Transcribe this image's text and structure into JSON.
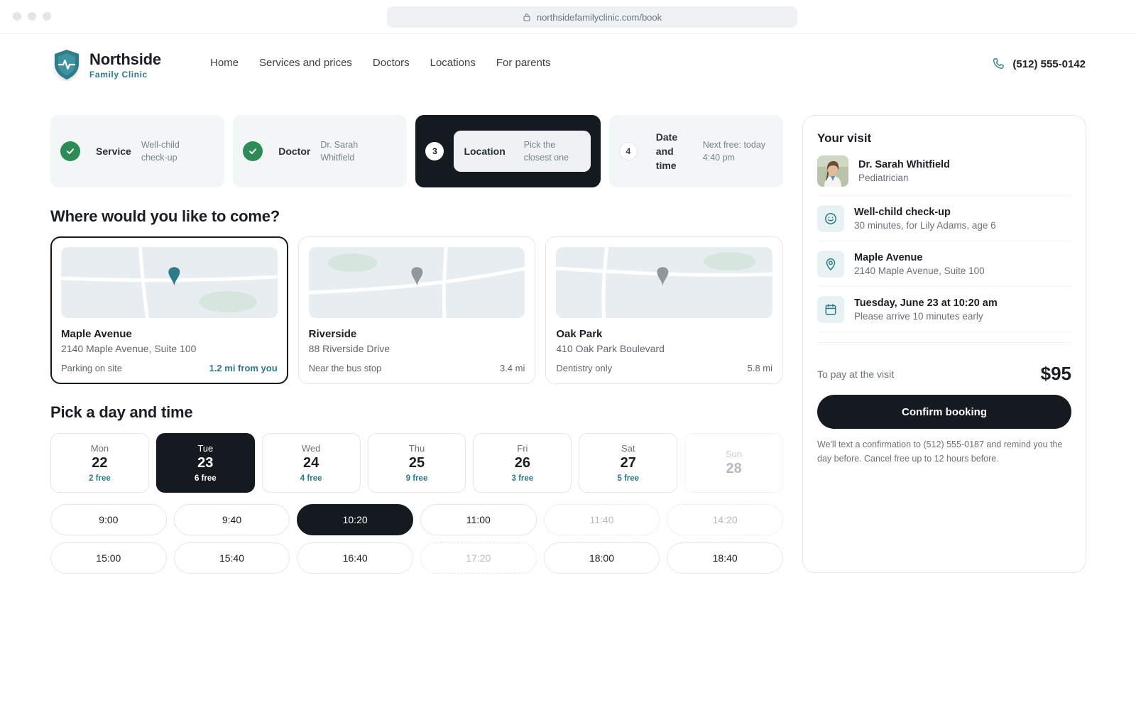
{
  "browser": {
    "url": "northsidefamilyclinic.com/book"
  },
  "brand": {
    "name": "Northside",
    "tagline": "Family Clinic",
    "color": "#2d7b87"
  },
  "nav": [
    "Home",
    "Services and prices",
    "Doctors",
    "Locations",
    "For parents"
  ],
  "phone": "(512) 555-0142",
  "steps": [
    {
      "label": "Service",
      "sub": "Well-child check-up",
      "status": "done"
    },
    {
      "label": "Doctor",
      "sub": "Dr. Sarah Whitfield",
      "status": "done"
    },
    {
      "number": "3",
      "label": "Location",
      "sub": "Pick the closest one",
      "status": "active"
    },
    {
      "number": "4",
      "label": "Date and time",
      "sub": "Next free: today 4:40 pm",
      "status": "pending"
    }
  ],
  "location_heading": "Where would you like to come?",
  "locations": [
    {
      "name": "Maple Avenue",
      "address": "2140 Maple Avenue, Suite 100",
      "note": "Parking on site",
      "distance": "1.2 mi from you",
      "selected": true
    },
    {
      "name": "Riverside",
      "address": "88 Riverside Drive",
      "note": "Near the bus stop",
      "distance": "3.4 mi",
      "selected": false
    },
    {
      "name": "Oak Park",
      "address": "410 Oak Park Boulevard",
      "note": "Dentistry only",
      "distance": "5.8 mi",
      "selected": false
    }
  ],
  "time_heading": "Pick a day and time",
  "days": [
    {
      "name": "Mon",
      "date": "22",
      "free": "2 free",
      "state": "normal"
    },
    {
      "name": "Tue",
      "date": "23",
      "free": "6 free",
      "state": "selected"
    },
    {
      "name": "Wed",
      "date": "24",
      "free": "4 free",
      "state": "normal"
    },
    {
      "name": "Thu",
      "date": "25",
      "free": "9 free",
      "state": "normal"
    },
    {
      "name": "Fri",
      "date": "26",
      "free": "3 free",
      "state": "normal"
    },
    {
      "name": "Sat",
      "date": "27",
      "free": "5 free",
      "state": "normal"
    },
    {
      "name": "Sun",
      "date": "28",
      "free": "",
      "state": "disabled"
    }
  ],
  "times": [
    {
      "time": "9:00",
      "state": "normal"
    },
    {
      "time": "9:40",
      "state": "normal"
    },
    {
      "time": "10:20",
      "state": "selected"
    },
    {
      "time": "11:00",
      "state": "normal"
    },
    {
      "time": "11:40",
      "state": "disabled"
    },
    {
      "time": "14:20",
      "state": "disabled"
    },
    {
      "time": "15:00",
      "state": "normal"
    },
    {
      "time": "15:40",
      "state": "normal"
    },
    {
      "time": "16:40",
      "state": "normal"
    },
    {
      "time": "17:20",
      "state": "disabled"
    },
    {
      "time": "18:00",
      "state": "normal"
    },
    {
      "time": "18:40",
      "state": "normal"
    }
  ],
  "summary": {
    "title": "Your visit",
    "doctor": {
      "name": "Dr. Sarah Whitfield",
      "role": "Pediatrician"
    },
    "service": {
      "name": "Well-child check-up",
      "detail": "30 minutes, for Lily Adams, age 6"
    },
    "location": {
      "name": "Maple Avenue",
      "detail": "2140 Maple Avenue, Suite 100"
    },
    "datetime": {
      "name": "Tuesday, June 23 at 10:20 am",
      "detail": "Please arrive 10 minutes early"
    },
    "pay_label": "To pay at the visit",
    "pay_value": "$95",
    "confirm_label": "Confirm booking",
    "note": "We'll text a confirmation to (512) 555-0187 and remind you the day before. Cancel free up to 12 hours before."
  },
  "icons": {
    "logo": "heartbeat-shield-icon",
    "phone": "phone-icon",
    "lock": "lock-icon",
    "check": "check-icon",
    "service": "smiley-icon",
    "location": "map-pin-icon",
    "calendar": "calendar-icon"
  }
}
